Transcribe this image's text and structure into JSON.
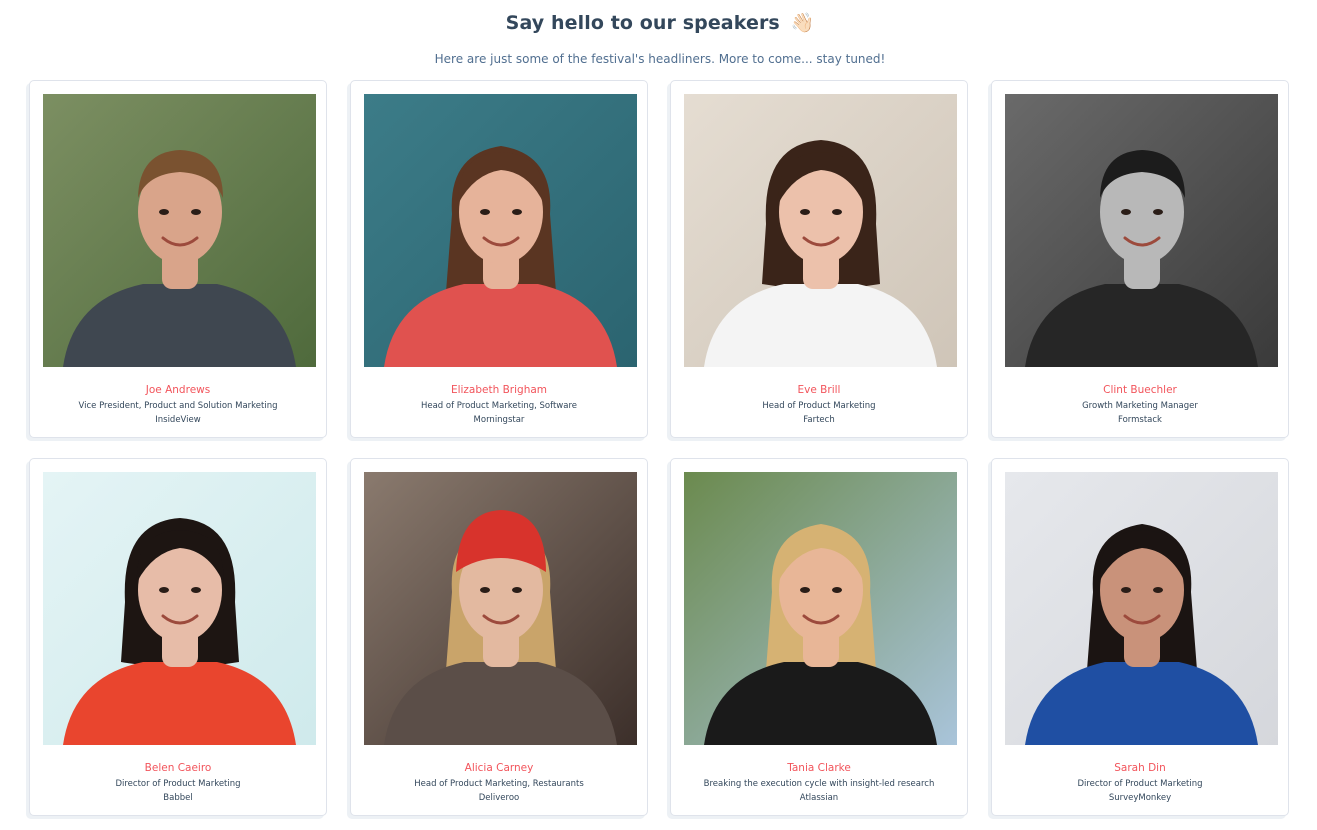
{
  "header": {
    "title": "Say hello to our speakers",
    "title_emoji": "👋🏻",
    "subtitle": "Here are just some of the festival's headliners. More to come... stay tuned!"
  },
  "colors": {
    "name_accent": "#f2545b",
    "text_primary": "#33475b",
    "card_border": "#dfe3eb"
  },
  "speakers": [
    {
      "name": "Joe Andrews",
      "role": "Vice President, Product and Solution Marketing",
      "company": "InsideView",
      "photo": {
        "bg": "#4f6a3c",
        "bg2": "#7c8f62",
        "skin": "#d9a48a",
        "hair": "#7a5230",
        "shirt": "#3f4750",
        "style": "short"
      }
    },
    {
      "name": "Elizabeth Brigham",
      "role": "Head of Product Marketing, Software",
      "company": "Morningstar",
      "photo": {
        "bg": "#2b6470",
        "bg2": "#3c7c88",
        "skin": "#e6b39a",
        "hair": "#5a3522",
        "shirt": "#e0524f",
        "style": "long"
      }
    },
    {
      "name": "Eve Brill",
      "role": "Head of Product Marketing",
      "company": "Fartech",
      "photo": {
        "bg": "#cfc5b8",
        "bg2": "#e5ddd2",
        "skin": "#ecc1ab",
        "hair": "#3a2419",
        "shirt": "#f4f4f4",
        "style": "bob"
      }
    },
    {
      "name": "Clint Buechler",
      "role": "Growth Marketing Manager",
      "company": "Formstack",
      "photo": {
        "bg": "#3a3a3a",
        "bg2": "#6a6a6a",
        "skin": "#b8b8b8",
        "hair": "#1c1c1c",
        "shirt": "#262626",
        "style": "short"
      }
    },
    {
      "name": "Belen Caeiro",
      "role": "Director of Product Marketing",
      "company": "Babbel",
      "photo": {
        "bg": "#cfeaec",
        "bg2": "#e4f4f5",
        "skin": "#e7bca8",
        "hair": "#1d1512",
        "shirt": "#e9452e",
        "style": "bob"
      }
    },
    {
      "name": "Alicia Carney",
      "role": "Head of Product Marketing, Restaurants",
      "company": "Deliveroo",
      "photo": {
        "bg": "#3c2f2a",
        "bg2": "#8a7a6e",
        "skin": "#e3b9a0",
        "hair": "#c9a46a",
        "shirt": "#5b4e48",
        "style": "hat"
      }
    },
    {
      "name": "Tania Clarke",
      "role": "Breaking the execution cycle with insight-led research",
      "company": "Atlassian",
      "photo": {
        "bg": "#a9c4da",
        "bg2": "#6b8a4e",
        "skin": "#e8b697",
        "hair": "#d6b273",
        "shirt": "#1a1a1a",
        "style": "long"
      }
    },
    {
      "name": "Sarah Din",
      "role": "Director of Product Marketing",
      "company": "SurveyMonkey",
      "photo": {
        "bg": "#d5d7dc",
        "bg2": "#e6e8ec",
        "skin": "#c9927a",
        "hair": "#1b1412",
        "shirt": "#1f4fa3",
        "style": "long"
      }
    }
  ]
}
